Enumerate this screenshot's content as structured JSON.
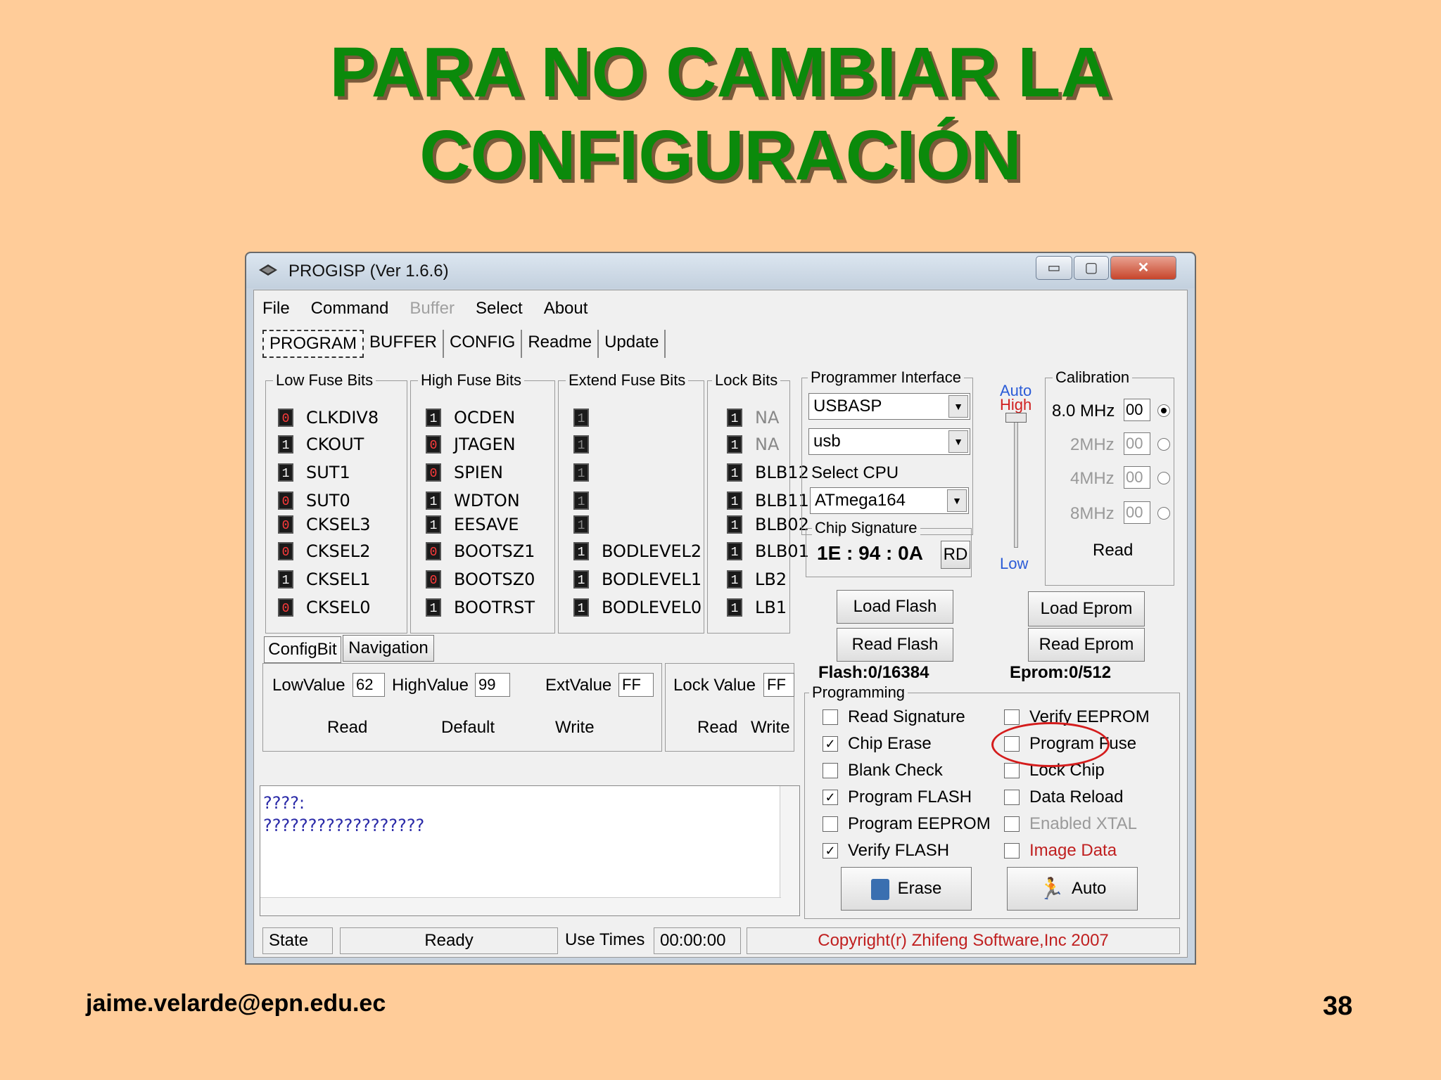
{
  "slide": {
    "title_line1": "PARA NO CAMBIAR LA",
    "title_line2": "CONFIGURACIÓN",
    "email": "jaime.velarde@epn.edu.ec",
    "page": "38"
  },
  "window": {
    "title": "PROGISP (Ver 1.6.6)",
    "min": "▭",
    "max": "▢",
    "close": "✕"
  },
  "menu": [
    "File",
    "Command",
    "Buffer",
    "Select",
    "About"
  ],
  "tabs": [
    "PROGRAM",
    "BUFFER",
    "CONFIG",
    "Readme",
    "Update"
  ],
  "fuses": {
    "low_title": "Low Fuse Bits",
    "high_title": "High Fuse Bits",
    "ext_title": "Extend Fuse Bits",
    "lock_title": "Lock Bits",
    "low": [
      {
        "bit": "0",
        "name": "CLKDIV8"
      },
      {
        "bit": "1",
        "name": "CKOUT"
      },
      {
        "bit": "1",
        "name": "SUT1"
      },
      {
        "bit": "0",
        "name": "SUT0"
      },
      {
        "bit": "0",
        "name": "CKSEL3"
      },
      {
        "bit": "0",
        "name": "CKSEL2"
      },
      {
        "bit": "1",
        "name": "CKSEL1"
      },
      {
        "bit": "0",
        "name": "CKSEL0"
      }
    ],
    "high": [
      {
        "bit": "1",
        "name": "OCDEN"
      },
      {
        "bit": "0",
        "name": "JTAGEN"
      },
      {
        "bit": "0",
        "name": "SPIEN"
      },
      {
        "bit": "1",
        "name": "WDTON"
      },
      {
        "bit": "1",
        "name": "EESAVE"
      },
      {
        "bit": "0",
        "name": "BOOTSZ1"
      },
      {
        "bit": "0",
        "name": "BOOTSZ0"
      },
      {
        "bit": "1",
        "name": "BOOTRST"
      }
    ],
    "ext": [
      {
        "bit": "1",
        "name": ""
      },
      {
        "bit": "1",
        "name": ""
      },
      {
        "bit": "1",
        "name": ""
      },
      {
        "bit": "1",
        "name": ""
      },
      {
        "bit": "1",
        "name": ""
      },
      {
        "bit": "1",
        "name": "BODLEVEL2"
      },
      {
        "bit": "1",
        "name": "BODLEVEL1"
      },
      {
        "bit": "1",
        "name": "BODLEVEL0"
      }
    ],
    "lock": [
      {
        "bit": "1",
        "name": "NA"
      },
      {
        "bit": "1",
        "name": "NA"
      },
      {
        "bit": "1",
        "name": "BLB12"
      },
      {
        "bit": "1",
        "name": "BLB11"
      },
      {
        "bit": "1",
        "name": "BLB02"
      },
      {
        "bit": "1",
        "name": "BLB01"
      },
      {
        "bit": "1",
        "name": "LB2"
      },
      {
        "bit": "1",
        "name": "LB1"
      }
    ]
  },
  "subtabs": [
    "ConfigBit",
    "Navigation"
  ],
  "values": {
    "low_label": "LowValue",
    "low": "62",
    "high_label": "HighValue",
    "high": "99",
    "ext_label": "ExtValue",
    "ext": "FF",
    "lock_label": "Lock Value",
    "lock": "FF",
    "read": "Read",
    "default": "Default",
    "write": "Write",
    "lock_read": "Read",
    "lock_write": "Write"
  },
  "log": {
    "line1": "????:",
    "line2": "??????????????????"
  },
  "programmer": {
    "title": "Programmer Interface",
    "interface": "USBASP",
    "port": "usb",
    "cpu_title": "Select CPU",
    "cpu": "ATmega164",
    "sig_title": "Chip Signature",
    "signature": "1E : 94 : 0A",
    "rd": "RD"
  },
  "auto": {
    "line1": "Auto",
    "line2": "High",
    "low": "Low"
  },
  "calibration": {
    "title": "Calibration",
    "rows": [
      {
        "freq": "8.0 MHz",
        "val": "00"
      },
      {
        "freq": "2MHz",
        "val": "00"
      },
      {
        "freq": "4MHz",
        "val": "00"
      },
      {
        "freq": "8MHz",
        "val": "00"
      }
    ],
    "read": "Read"
  },
  "buttons": {
    "load_flash": "Load Flash",
    "read_flash": "Read Flash",
    "load_eprom": "Load Eprom",
    "read_eprom": "Read Eprom",
    "erase": "Erase",
    "auto": "Auto"
  },
  "counters": {
    "flash": "Flash:0/16384",
    "eprom": "Eprom:0/512"
  },
  "programming": {
    "title": "Programming",
    "left": [
      {
        "label": "Read Signature",
        "checked": ""
      },
      {
        "label": "Chip Erase",
        "checked": "✓"
      },
      {
        "label": "Blank Check",
        "checked": ""
      },
      {
        "label": "Program FLASH",
        "checked": "✓"
      },
      {
        "label": "Program EEPROM",
        "checked": ""
      },
      {
        "label": "Verify FLASH",
        "checked": "✓"
      }
    ],
    "right": [
      {
        "label": "Verify EEPROM",
        "checked": ""
      },
      {
        "label": "Program Fuse",
        "checked": ""
      },
      {
        "label": "Lock Chip",
        "checked": ""
      },
      {
        "label": "Data Reload",
        "checked": ""
      },
      {
        "label": "Enabled XTAL",
        "checked": ""
      },
      {
        "label": "Image Data",
        "checked": ""
      }
    ]
  },
  "status": {
    "state": "State",
    "ready": "Ready",
    "use_times": "Use Times",
    "time": "00:00:00",
    "copyright": "Copyright(r) Zhifeng Software,Inc 2007"
  },
  "colors": {
    "title_green": "#0B8A0B",
    "background": "#FFCC99",
    "highlight_red": "#D41C1C"
  }
}
